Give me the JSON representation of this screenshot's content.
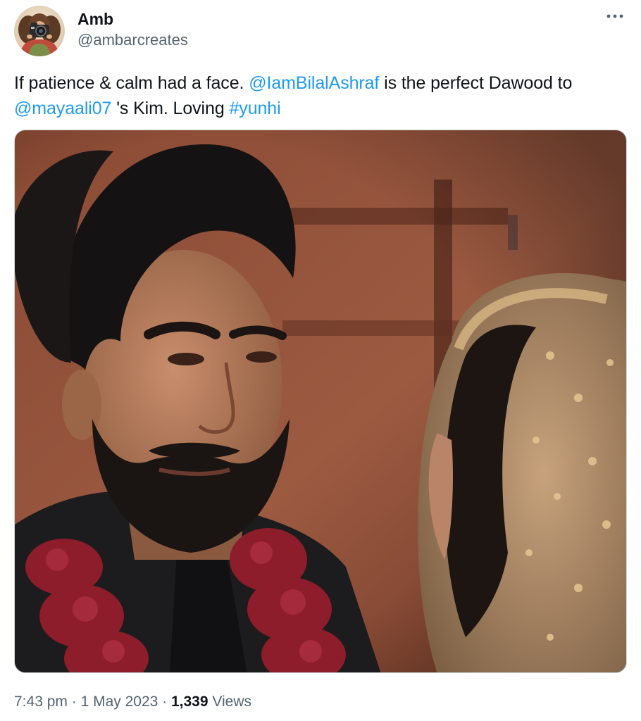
{
  "author": {
    "display_name": "Amb",
    "handle": "@ambarcreates",
    "avatar_icon": "avatar-photographer"
  },
  "more_icon": "more-horizontal-icon",
  "tweet": {
    "text_1": "If patience & calm had a face. ",
    "mention_1": "@IamBilalAshraf",
    "text_2": " is the perfect Dawood to ",
    "mention_2": "@mayaali07",
    "text_3": " 's Kim. Loving ",
    "hashtag": "#yunhi"
  },
  "meta": {
    "time": "7:43 pm",
    "separator": " · ",
    "date": "1 May 2023",
    "views_count": "1,339",
    "views_label": " Views"
  },
  "colors": {
    "link": "#1d9bf0",
    "secondary_text": "#536471",
    "primary_text": "#0f1419"
  }
}
